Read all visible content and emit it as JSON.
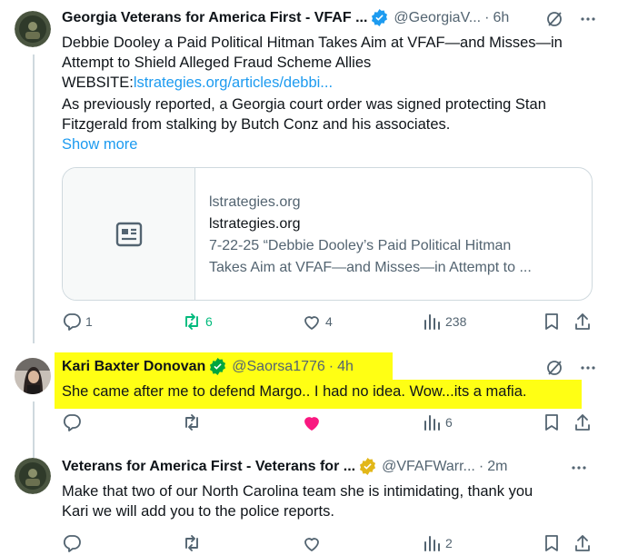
{
  "tweets": [
    {
      "display_name": "Georgia Veterans for America First - VFAF ...",
      "handle": "@GeorgiaV...",
      "time": "6h",
      "verified": "blue",
      "text_line1": "Debbie Dooley a Paid Political Hitman Takes Aim at VFAF—and Misses—in",
      "text_line2": "Attempt to Shield Alleged Fraud Scheme Allies",
      "website_label": "WEBSITE:",
      "website_link": "lstrategies.org/articles/debbi...",
      "text_line4": "As previously reported, a Georgia court order was signed protecting Stan",
      "text_line5": "Fitzgerald from stalking by Butch Conz and his associates.",
      "show_more": "Show more",
      "card": {
        "domain": "lstrategies.org",
        "title": "lstrategies.org",
        "desc_line1": "7-22-25 “Debbie Dooley’s Paid Political Hitman",
        "desc_line2": "Takes Aim at VFAF—and Misses—in Attempt to ..."
      },
      "replies": "1",
      "reposts": "6",
      "likes": "4",
      "views": "238"
    },
    {
      "display_name": "Kari Baxter Donovan",
      "handle": "@Saorsa1776",
      "time": "4h",
      "verified": "gold",
      "text": "She came after me to defend Margo.. I had no idea. Wow...its a mafia.",
      "replies": "",
      "reposts": "",
      "likes": "",
      "views": "6"
    },
    {
      "display_name": "Veterans for America First - Veterans for ...",
      "handle": "@VFAFWarr...",
      "time": "2m",
      "verified": "gold",
      "text_line1": "Make that two of our North Carolina team she is intimidating, thank you",
      "text_line2": "Kari we will add you to the police reports.",
      "replies": "",
      "reposts": "",
      "likes": "",
      "views": "2"
    }
  ],
  "colors": {
    "accent": "#1d9bf0",
    "repost_active": "#00ba7c",
    "like_active": "#f91880",
    "highlight": "#ffff14",
    "gold_badge": "#e2b719",
    "muted": "#536471"
  },
  "icons": [
    "grok-icon",
    "more-icon",
    "reply-icon",
    "repost-icon",
    "like-icon",
    "views-icon",
    "bookmark-icon",
    "share-icon",
    "article-icon",
    "verified-badge"
  ]
}
